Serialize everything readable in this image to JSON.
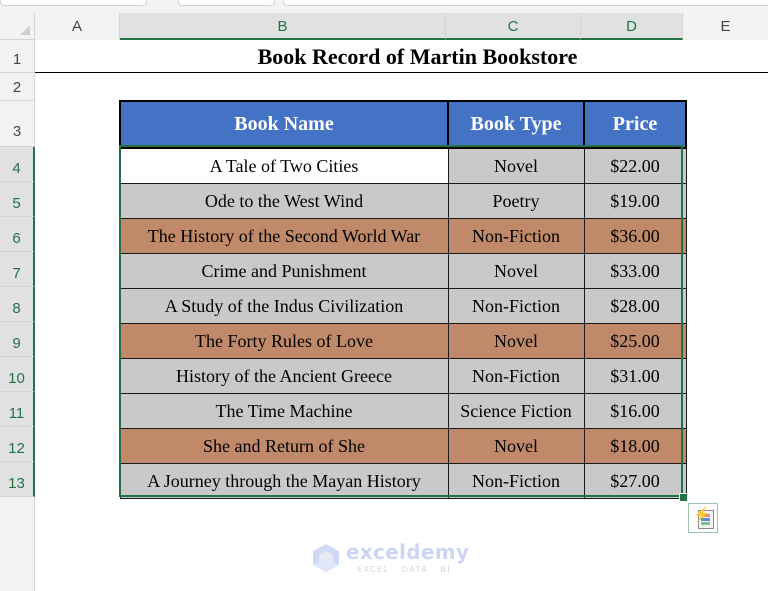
{
  "spreadsheet": {
    "columns": [
      "A",
      "B",
      "C",
      "D",
      "E"
    ],
    "selected_columns": [
      "B",
      "C",
      "D"
    ],
    "rows": [
      "1",
      "2",
      "3",
      "4",
      "5",
      "6",
      "7",
      "8",
      "9",
      "10",
      "11",
      "12",
      "13"
    ],
    "selected_rows": [
      "4",
      "5",
      "6",
      "7",
      "8",
      "9",
      "10",
      "11",
      "12",
      "13"
    ]
  },
  "title": "Book Record of Martin Bookstore",
  "table": {
    "headers": [
      "Book Name",
      "Book Type",
      "Price"
    ],
    "rows": [
      {
        "name": "A Tale of Two Cities",
        "type": "Novel",
        "price": "$22.00",
        "highlight": "partial"
      },
      {
        "name": "Ode to the West Wind",
        "type": "Poetry",
        "price": "$19.00",
        "highlight": "gray"
      },
      {
        "name": "The History of the Second World War",
        "type": "Non-Fiction",
        "price": "$36.00",
        "highlight": "brown"
      },
      {
        "name": "Crime and Punishment",
        "type": "Novel",
        "price": "$33.00",
        "highlight": "gray"
      },
      {
        "name": "A Study of the Indus Civilization",
        "type": "Non-Fiction",
        "price": "$28.00",
        "highlight": "gray"
      },
      {
        "name": "The Forty Rules of Love",
        "type": "Novel",
        "price": "$25.00",
        "highlight": "brown"
      },
      {
        "name": "History of the Ancient Greece",
        "type": "Non-Fiction",
        "price": "$31.00",
        "highlight": "gray"
      },
      {
        "name": "The Time Machine",
        "type": "Science Fiction",
        "price": "$16.00",
        "highlight": "gray"
      },
      {
        "name": "She and Return of She",
        "type": "Novel",
        "price": "$18.00",
        "highlight": "brown"
      },
      {
        "name": "A Journey through the Mayan History",
        "type": "Non-Fiction",
        "price": "$27.00",
        "highlight": "gray"
      }
    ]
  },
  "colors": {
    "header_bg": "#4472C4",
    "gray_fill": "#C9C9C9",
    "brown_fill": "#C0896A",
    "white_fill": "#FFFFFF",
    "selection": "#217346"
  },
  "quick_analysis": {
    "icon": "quick-analysis-icon"
  },
  "watermark": {
    "name": "exceldemy",
    "tagline": "EXCEL · DATA · BI"
  }
}
